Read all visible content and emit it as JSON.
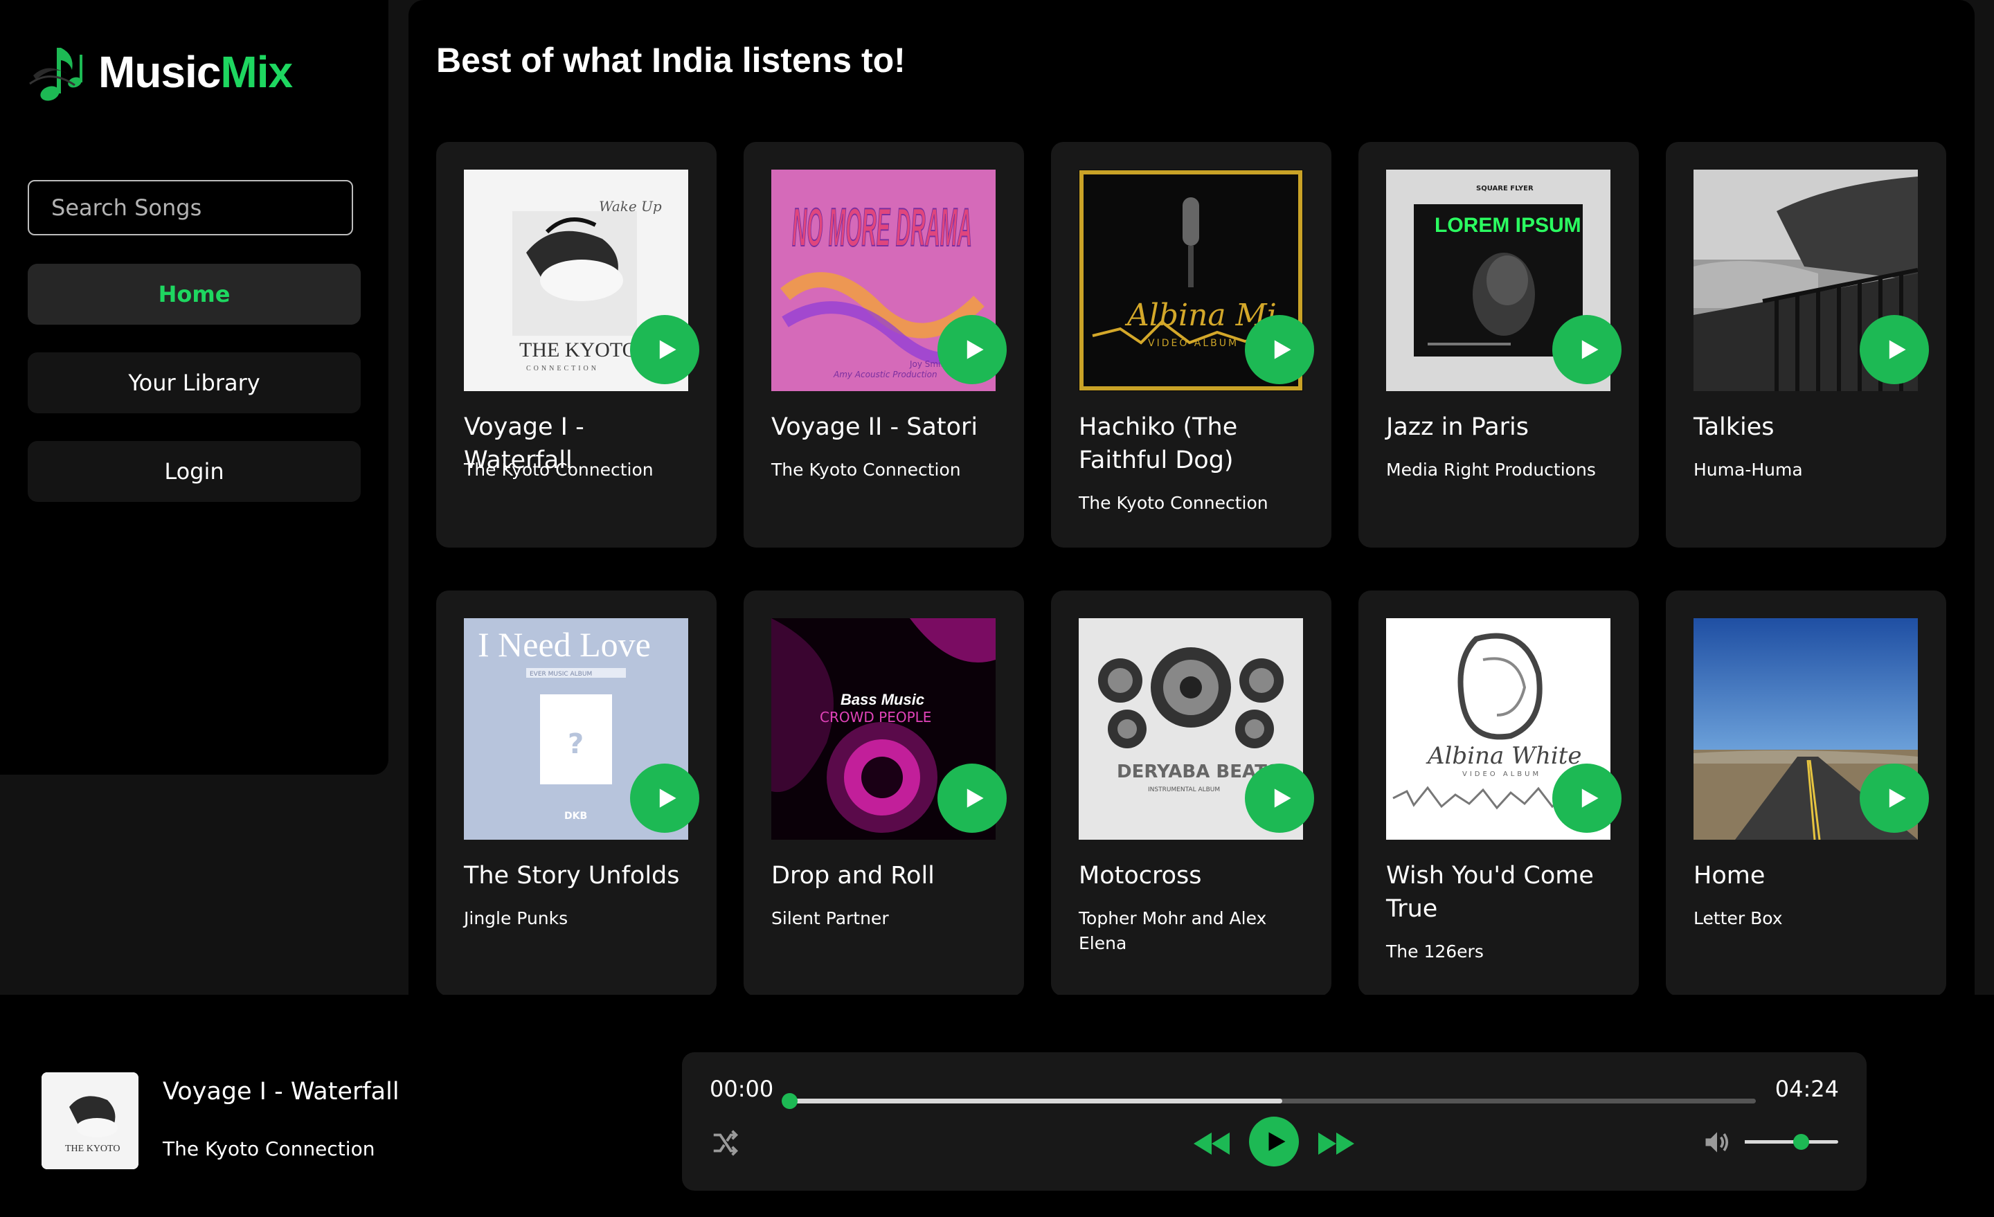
{
  "app": {
    "logo_part1": "Music",
    "logo_part2": "Mix",
    "accent_color": "#1db954"
  },
  "sidebar": {
    "search_placeholder": "Search Songs",
    "items": [
      {
        "label": "Home",
        "active": true
      },
      {
        "label": "Your Library",
        "active": false
      },
      {
        "label": "Login",
        "active": false
      }
    ]
  },
  "main": {
    "title": "Best of what India listens to!",
    "songs": [
      {
        "title": "Voyage I - Waterfall",
        "artist": "The Kyoto Connection",
        "cover_text": "THE KYOTO",
        "cover_subtext": "CONNECTION",
        "cover_script": "Wake Up"
      },
      {
        "title": "Voyage II - Satori",
        "artist": "The Kyoto Connection",
        "cover_text": "NO MORE DRAMA",
        "cover_subtext": "Joy Smith",
        "cover_script": "Amy Acoustic Production"
      },
      {
        "title": "Hachiko (The Faithful Dog)",
        "artist": "The Kyoto Connection",
        "cover_text": "Albina Mi",
        "cover_subtext": "VIDEO ALBUM"
      },
      {
        "title": "Jazz in Paris",
        "artist": "Media Right Productions",
        "cover_text": "LOREM IPSUM",
        "cover_subtext": "SQUARE FLYER"
      },
      {
        "title": "Talkies",
        "artist": "Huma-Huma"
      },
      {
        "title": "The Story Unfolds",
        "artist": "Jingle Punks",
        "cover_text": "I Need Love",
        "cover_subtext": "EVER MUSIC ALBUM",
        "cover_script": "DKB"
      },
      {
        "title": "Drop and Roll",
        "artist": "Silent Partner",
        "cover_text": "Bass Music",
        "cover_subtext": "CROWD PEOPLE"
      },
      {
        "title": "Motocross",
        "artist": "Topher Mohr and Alex Elena",
        "cover_text": "DERYABA BEATS",
        "cover_subtext": "INSTRUMENTAL ALBUM"
      },
      {
        "title": "Wish You'd Come True",
        "artist": "The 126ers",
        "cover_text": "Albina White",
        "cover_subtext": "VIDEO ALBUM"
      },
      {
        "title": "Home",
        "artist": "Letter Box"
      }
    ]
  },
  "player": {
    "now_playing_title": "Voyage I - Waterfall",
    "now_playing_artist": "The Kyoto Connection",
    "art_text": "THE KYOTO",
    "current_time": "00:00",
    "duration": "04:24",
    "progress": 0,
    "buffered": 0.51,
    "volume": 0.6
  }
}
